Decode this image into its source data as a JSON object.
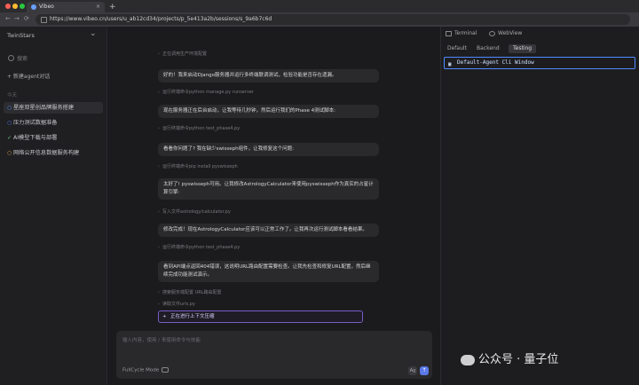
{
  "browser": {
    "tab_title": "Vibeo",
    "close": "×",
    "new_tab": "+",
    "url": "https://www.vibeo.cn/users/u_ab12cd34/projects/p_5e413a2b/sessions/s_9a6b7c6d",
    "back": "←",
    "forward": "→",
    "reload": "⟳"
  },
  "sidebar": {
    "title": "TwinStars",
    "search_placeholder": "搜索",
    "new_label": "+ 新建agent对话",
    "section": "今天",
    "items": [
      {
        "icon": "○",
        "label": "星座双星创品牌服务搭建",
        "active": true
      },
      {
        "icon": "○",
        "label": "压力测试数据准备",
        "active": false
      },
      {
        "icon": "✓",
        "label": "AI模型下载与部署",
        "active": false
      },
      {
        "icon": "○",
        "label": "网络公开信息数据服务构建",
        "active": false
      }
    ]
  },
  "chat": {
    "top_tool": "正在调用生产环境配置",
    "messages": [
      {
        "text": "好的！我来启动Django服务器并运行多终端联调测试，检验功能是否存在遗漏。"
      },
      {
        "text": "现在服务器正在后台启动，让我等待几秒钟，然后运行我们的Phase 4测试脚本:"
      },
      {
        "text": "看看你问题了? 我在缺少swisseph组件，让我修复这个问题:"
      },
      {
        "text": "太好了! pyswisseph可用。让我修改AstrologyCalculator来使用pyswisseph作为真实的占星计算引擎:"
      },
      {
        "text": "修改完成！现在AstrologyCalculator应该可以正常工作了。让我再次运行测试脚本看看结果。"
      },
      {
        "text": "看到API端点返回404错误，这说明URL路由配置需要检查。让我先检查和修复URL配置，然后继续完成功能测试演示。"
      }
    ],
    "tools": [
      "运行终端命令python manage.py runserver",
      "运行终端命令python test_phase4.py",
      "运行终端命令pip install pyswisseph",
      "写入文件astrology/calculator.py",
      "运行终端命令python test_phase4.py",
      "搜索服务端配置 URL路由配置",
      "读取文件urls.py"
    ],
    "progress": "正在进行上下文压缩",
    "progress_icon": "+",
    "composer_placeholder": "输入内容，使用 / 来使用命令与技能",
    "mode_label": "FullCycle Mode",
    "attach": "Ag",
    "send": "↑"
  },
  "right_panel": {
    "tabs": [
      "Terminal",
      "WebView"
    ],
    "subtabs": [
      "Default",
      "Backend",
      "Testing"
    ],
    "active_subtab": "Testing",
    "terminal_icon": "▣",
    "terminal_window": "Default-Agent Cli Window"
  },
  "watermark": "公众号 · 量子位",
  "colors": {
    "accent": "#4f8cff",
    "progress_border": "#7a5cc8",
    "send": "#5b7ae8"
  }
}
